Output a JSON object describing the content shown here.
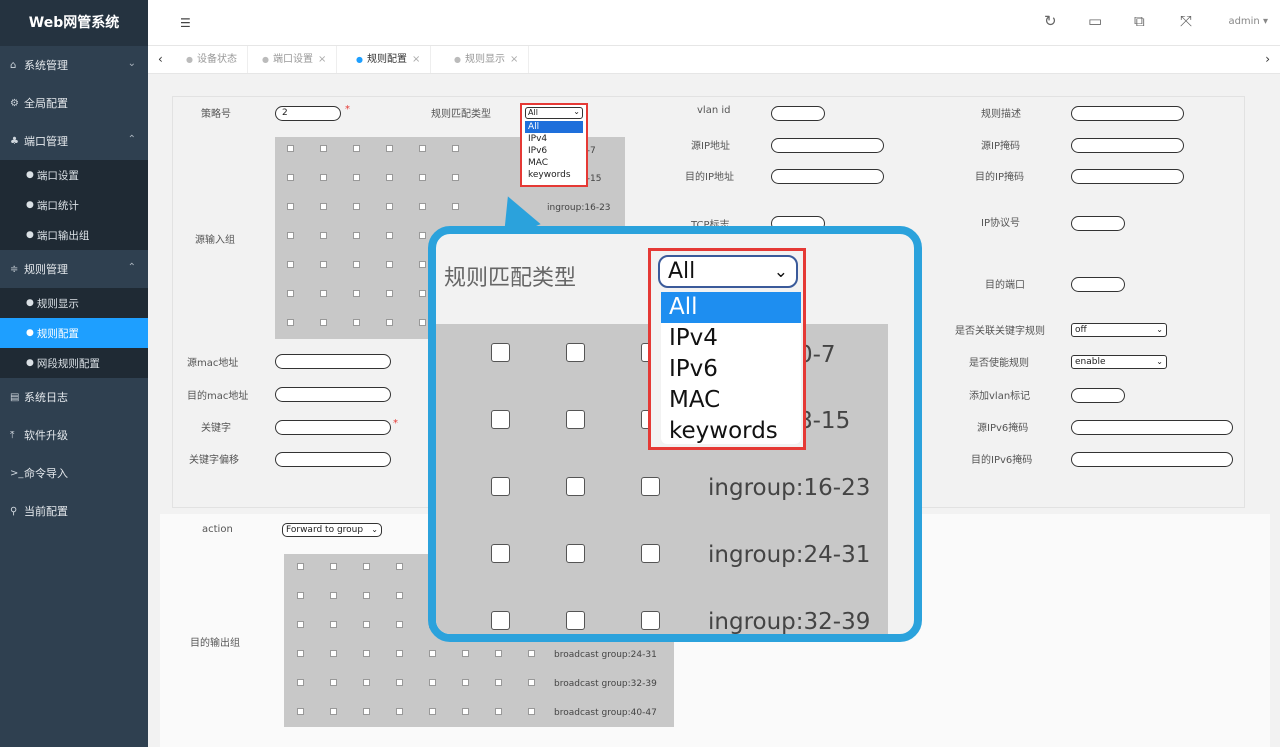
{
  "app": {
    "title": "Web网管系统"
  },
  "sidebar": {
    "groups": [
      {
        "label": "系统管理",
        "icon": "home-icon"
      },
      {
        "label": "全局配置",
        "icon": "gears-icon"
      },
      {
        "label": "端口管理",
        "icon": "network-icon",
        "items": [
          "端口设置",
          "端口统计",
          "端口输出组"
        ]
      },
      {
        "label": "规则管理",
        "icon": "sliders-icon",
        "items": [
          "规则显示",
          "规则配置",
          "网段规则配置"
        ]
      },
      {
        "label": "系统日志",
        "icon": "file-icon"
      },
      {
        "label": "软件升级",
        "icon": "upload-icon"
      },
      {
        "label": "命令导入",
        "icon": "terminal-icon"
      },
      {
        "label": "当前配置",
        "icon": "pin-icon"
      }
    ],
    "active_item": "规则配置"
  },
  "topbar": {
    "user": "admin",
    "icons": [
      "menu-icon",
      "refresh-icon",
      "save-icon",
      "copy-icon",
      "fullscreen-icon"
    ]
  },
  "tabs": [
    {
      "label": "设备状态",
      "closable": false
    },
    {
      "label": "端口设置",
      "closable": true
    },
    {
      "label": "规则配置",
      "closable": true,
      "active": true
    },
    {
      "label": "规则显示",
      "closable": true
    }
  ],
  "form": {
    "policy_no": {
      "label": "策略号",
      "value": "2"
    },
    "match_type": {
      "label": "规则匹配类型",
      "value": "All",
      "options": [
        "All",
        "IPv4",
        "IPv6",
        "MAC",
        "keywords"
      ]
    },
    "vlan_id": {
      "label": "vlan id"
    },
    "rule_desc": {
      "label": "规则描述"
    },
    "src_ip": {
      "label": "源IP地址"
    },
    "src_ip_mask": {
      "label": "源IP掩码"
    },
    "dst_ip": {
      "label": "目的IP地址"
    },
    "dst_ip_mask": {
      "label": "目的IP掩码"
    },
    "tcp_flag": {
      "label": "TCP标志"
    },
    "ip_proto": {
      "label": "IP协议号"
    },
    "dst_port": {
      "label": "目的端口"
    },
    "assoc_keyword": {
      "label": "是否关联关键字规则",
      "value": "off"
    },
    "enable_rule": {
      "label": "是否使能规则",
      "value": "enable"
    },
    "add_vlan_tag": {
      "label": "添加vlan标记"
    },
    "src_ipv6_mask": {
      "label": "源IPv6掩码"
    },
    "dst_ipv6_mask": {
      "label": "目的IPv6掩码"
    },
    "src_mac": {
      "label": "源mac地址"
    },
    "dst_mac": {
      "label": "目的mac地址"
    },
    "keyword": {
      "label": "关键字"
    },
    "keyword_offset": {
      "label": "关键字偏移"
    },
    "input_group": {
      "label": "源输入组",
      "groups": [
        "ingroup:0-7",
        "ingroup:8-15",
        "ingroup:16-23",
        "ingroup:24-31",
        "ingroup:32-39"
      ],
      "visible_labels": [
        "0-7",
        "8-15",
        "ingroup:16-23"
      ]
    }
  },
  "action": {
    "label": "action",
    "value": "Forward to group",
    "output_label": "目的输出组",
    "groups": [
      "broadcast group:24-31",
      "broadcast group:32-39",
      "broadcast group:40-47"
    ]
  },
  "zoom": {
    "label": "规则匹配类型",
    "value": "All",
    "options": [
      "All",
      "IPv4",
      "IPv6",
      "MAC",
      "keywords"
    ],
    "groups": [
      "0-7",
      "8-15",
      "ingroup:16-23",
      "ingroup:24-31",
      "ingroup:32-39"
    ]
  },
  "colors": {
    "sidebar_bg": "#2f4050",
    "accent": "#1e9fff",
    "callout": "#2ba2dc",
    "highlight_border": "#e53935"
  }
}
